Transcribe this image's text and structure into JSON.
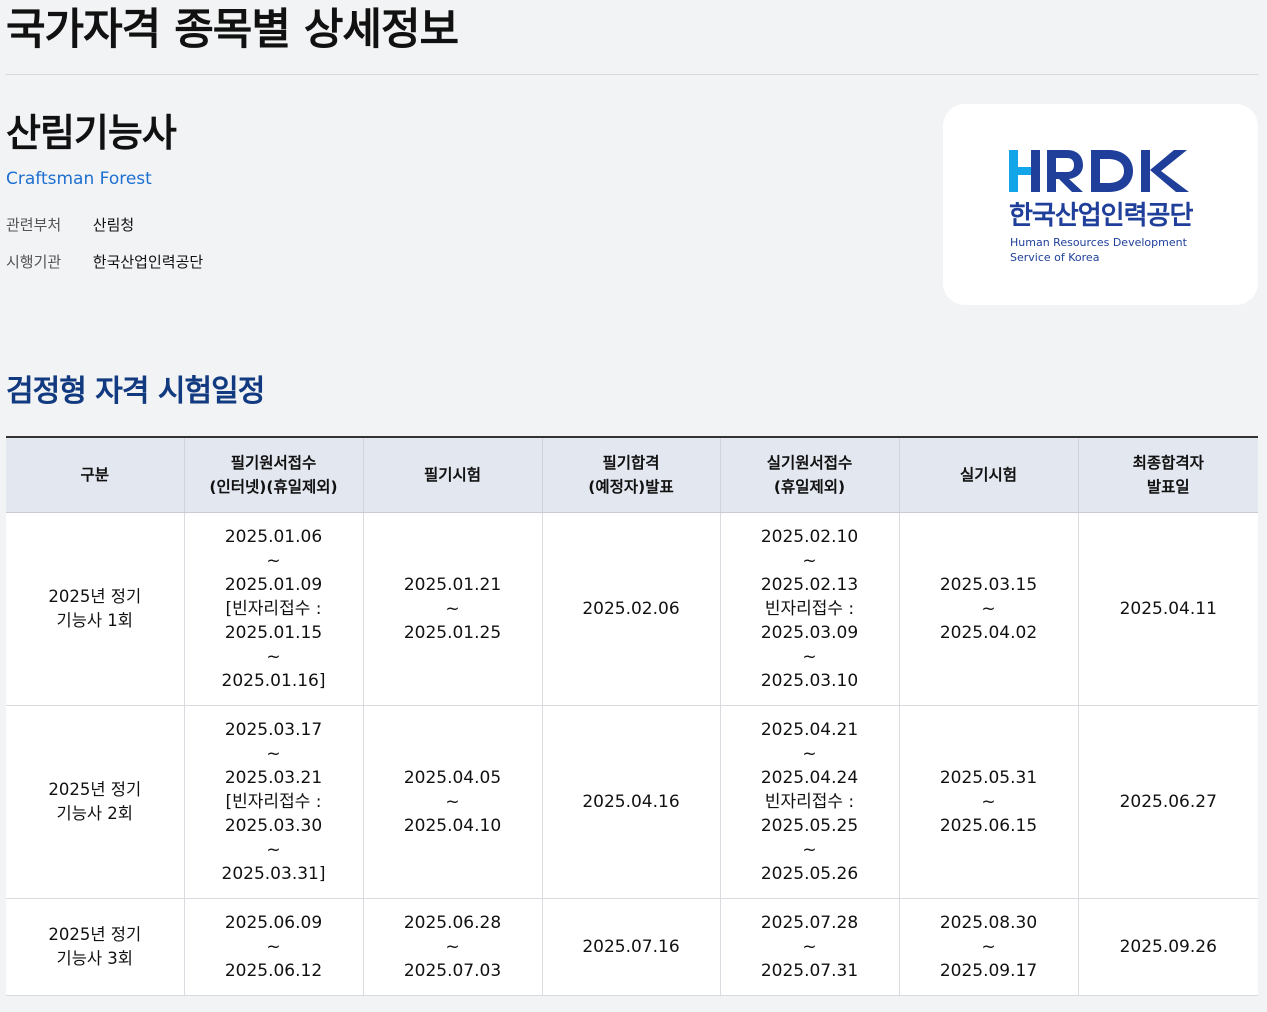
{
  "page": {
    "title": "국가자격 종목별 상세정보"
  },
  "certificate": {
    "name": "산림기능사",
    "english_name": "Craftsman Forest",
    "meta": [
      {
        "label": "관련부처",
        "value": "산림청"
      },
      {
        "label": "시행기관",
        "value": "한국산업인력공단"
      }
    ]
  },
  "logo": {
    "wordmark": "HRDK",
    "korean": "한국산업인력공단",
    "english_line1": "Human Resources Development",
    "english_line2": "Service of Korea",
    "colors": {
      "light_blue": "#12a5e8",
      "dark_blue": "#1f3f9a"
    }
  },
  "schedule": {
    "section_title": "검정형 자격 시험일정",
    "headers": [
      "구분",
      "필기원서접수\n(인터넷)(휴일제외)",
      "필기시험",
      "필기합격\n(예정자)발표",
      "실기원서접수\n(휴일제외)",
      "실기시험",
      "최종합격자\n발표일"
    ],
    "rows": [
      {
        "round": "2025년 정기 기능사 1회",
        "written_application": "2025.01.06\n~\n2025.01.09\n[빈자리접수 :\n2025.01.15\n~\n2025.01.16]",
        "written_exam": "2025.01.21\n~\n2025.01.25",
        "written_result": "2025.02.06",
        "practical_application": "2025.02.10\n~\n2025.02.13\n빈자리접수 :\n2025.03.09\n~\n2025.03.10",
        "practical_exam": "2025.03.15\n~\n2025.04.02",
        "final_result": "2025.04.11"
      },
      {
        "round": "2025년 정기 기능사 2회",
        "written_application": "2025.03.17\n~\n2025.03.21\n[빈자리접수 :\n2025.03.30\n~\n2025.03.31]",
        "written_exam": "2025.04.05\n~\n2025.04.10",
        "written_result": "2025.04.16",
        "practical_application": "2025.04.21\n~\n2025.04.24\n빈자리접수 :\n2025.05.25\n~\n2025.05.26",
        "practical_exam": "2025.05.31\n~\n2025.06.15",
        "final_result": "2025.06.27"
      },
      {
        "round": "2025년 정기 기능사 3회",
        "written_application": "2025.06.09\n~\n2025.06.12",
        "written_exam": "2025.06.28\n~\n2025.07.03",
        "written_result": "2025.07.16",
        "practical_application": "2025.07.28\n~\n2025.07.31",
        "practical_exam": "2025.08.30\n~\n2025.09.17",
        "final_result": "2025.09.26"
      }
    ]
  }
}
